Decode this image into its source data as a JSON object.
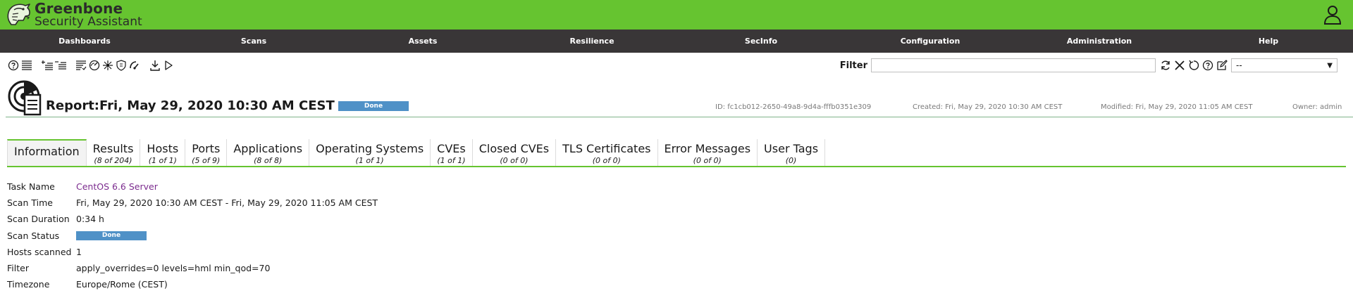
{
  "app": {
    "logo_line1": "Greenbone",
    "logo_line2": "Security Assistant",
    "brand_green": "#66c430",
    "nav_bg": "#393637"
  },
  "nav": [
    "Dashboards",
    "Scans",
    "Assets",
    "Resilience",
    "SecInfo",
    "Configuration",
    "Administration",
    "Help"
  ],
  "toolbar": {
    "icons": [
      "help-icon",
      "list-icon",
      "add-to-results-icon",
      "remove-from-results-icon",
      "list-results-icon",
      "performance-icon",
      "vulnerability-icon",
      "report-tls-icon",
      "dashboard-gauge-icon",
      "download-icon",
      "trigger-icon"
    ]
  },
  "filter": {
    "label": "Filter",
    "value": "",
    "select_value": "--",
    "icons": [
      "refresh-icon",
      "delete-icon",
      "reset-icon",
      "help-icon",
      "edit-icon"
    ]
  },
  "report": {
    "title": "Report:Fri, May 29, 2020 10:30 AM CEST",
    "status": "Done",
    "id": "ID: fc1cb012-2650-49a8-9d4a-fffb0351e309",
    "created": "Created: Fri, May 29, 2020 10:30 AM CEST",
    "modified": "Modified: Fri, May 29, 2020 11:05 AM CEST",
    "owner": "Owner: admin"
  },
  "tabs": [
    {
      "label": "Information",
      "count": ""
    },
    {
      "label": "Results",
      "count": "(8 of 204)"
    },
    {
      "label": "Hosts",
      "count": "(1 of 1)"
    },
    {
      "label": "Ports",
      "count": "(5 of 9)"
    },
    {
      "label": "Applications",
      "count": "(8 of 8)"
    },
    {
      "label": "Operating Systems",
      "count": "(1 of 1)"
    },
    {
      "label": "CVEs",
      "count": "(1 of 1)"
    },
    {
      "label": "Closed CVEs",
      "count": "(0 of 0)"
    },
    {
      "label": "TLS Certificates",
      "count": "(0 of 0)"
    },
    {
      "label": "Error Messages",
      "count": "(0 of 0)"
    },
    {
      "label": "User Tags",
      "count": "(0)"
    }
  ],
  "info": {
    "task_name_label": "Task Name",
    "task_name": "CentOS 6.6 Server",
    "scan_time_label": "Scan Time",
    "scan_time": "Fri, May 29, 2020 10:30 AM CEST - Fri, May 29, 2020 11:05 AM CEST",
    "scan_duration_label": "Scan Duration",
    "scan_duration": "0:34 h",
    "scan_status_label": "Scan Status",
    "scan_status": "Done",
    "hosts_scanned_label": "Hosts scanned",
    "hosts_scanned": "1",
    "filter_label": "Filter",
    "filter": "apply_overrides=0 levels=hml min_qod=70",
    "timezone_label": "Timezone",
    "timezone": "Europe/Rome (CEST)"
  }
}
